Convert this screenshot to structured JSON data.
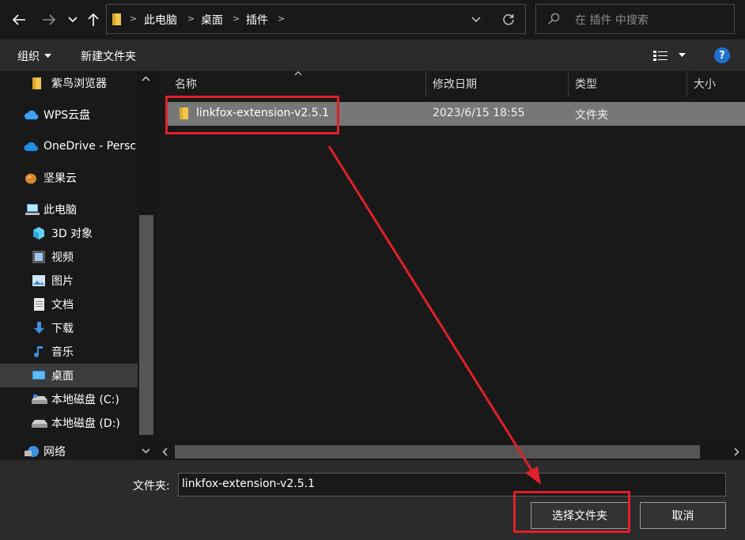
{
  "address_bar": {
    "crumbs": [
      "此电脑",
      "桌面",
      "插件"
    ],
    "search_placeholder": "在 插件 中搜索"
  },
  "command_bar": {
    "organize_label": "组织",
    "new_folder_label": "新建文件夹",
    "help_label": "?"
  },
  "navigation": {
    "items": [
      {
        "label": "紫鸟浏览器",
        "icon": "folder-icon"
      },
      {
        "label": "WPS云盘",
        "icon": "cloud-icon"
      },
      {
        "label": "OneDrive - Persc",
        "icon": "onedrive-icon"
      },
      {
        "label": "坚果云",
        "icon": "nut-icon"
      },
      {
        "label": "此电脑",
        "icon": "computer-icon"
      },
      {
        "label": "3D 对象",
        "icon": "cube-icon"
      },
      {
        "label": "视频",
        "icon": "video-icon"
      },
      {
        "label": "图片",
        "icon": "picture-icon"
      },
      {
        "label": "文档",
        "icon": "document-icon"
      },
      {
        "label": "下载",
        "icon": "download-icon"
      },
      {
        "label": "音乐",
        "icon": "music-icon"
      },
      {
        "label": "桌面",
        "icon": "desktop-icon",
        "selected": true
      },
      {
        "label": "本地磁盘 (C:)",
        "icon": "drive-icon"
      },
      {
        "label": "本地磁盘 (D:)",
        "icon": "drive-icon"
      },
      {
        "label": "网络",
        "icon": "network-icon"
      }
    ]
  },
  "file_list": {
    "columns": [
      "名称",
      "修改日期",
      "类型",
      "大小"
    ],
    "rows": [
      {
        "name": "linkfox-extension-v2.5.1",
        "modified": "2023/6/15 18:55",
        "type": "文件夹",
        "size": ""
      }
    ]
  },
  "footer": {
    "folder_label": "文件夹:",
    "folder_value": "linkfox-extension-v2.5.1",
    "select_button": "选择文件夹",
    "cancel_button": "取消"
  },
  "colors": {
    "annotation_red": "#e0202a",
    "selection_gray": "#777777",
    "folder_yellow": "#f3c74b",
    "help_blue": "#1f6fd0"
  }
}
